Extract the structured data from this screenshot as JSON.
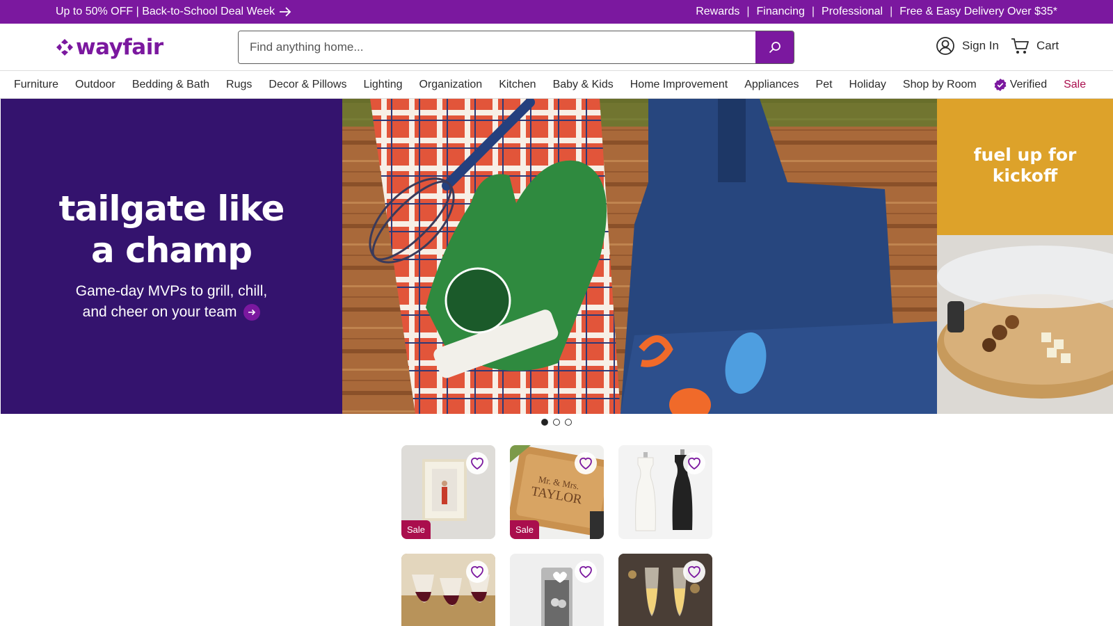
{
  "promo": {
    "left_text": "Up to 50% OFF | Back-to-School Deal Week",
    "links": [
      "Rewards",
      "Financing",
      "Professional",
      "Free & Easy Delivery Over $35*"
    ]
  },
  "header": {
    "logo": "wayfair",
    "search_placeholder": "Find anything home...",
    "sign_in": "Sign In",
    "cart": "Cart"
  },
  "nav": {
    "items": [
      "Furniture",
      "Outdoor",
      "Bedding & Bath",
      "Rugs",
      "Decor & Pillows",
      "Lighting",
      "Organization",
      "Kitchen",
      "Baby & Kids",
      "Home Improvement",
      "Appliances",
      "Pet",
      "Holiday",
      "Shop by Room"
    ],
    "verified": "Verified",
    "sale": "Sale"
  },
  "hero": {
    "title_line1": "tailgate like",
    "title_line2": "a champ",
    "sub_line1": "Game-day MVPs to grill, chill,",
    "sub_line2": "and cheer on your team",
    "side_title_line1": "fuel up for",
    "side_title_line2": "kickoff",
    "slides_total": 3,
    "slide_active": 1
  },
  "products": {
    "sale_label": "Sale",
    "items": [
      {
        "type": "picture frame",
        "sale": true
      },
      {
        "type": "cutting board",
        "sale": true
      },
      {
        "type": "salt and pepper mills",
        "sale": false
      },
      {
        "type": "wine glasses",
        "sale": false
      },
      {
        "type": "photo ornament",
        "sale": false
      },
      {
        "type": "champagne flutes",
        "sale": false
      }
    ],
    "board_engraving_line1": "Mr. & Mrs.",
    "board_engraving_line2": "TAYLOR"
  },
  "colors": {
    "brand_purple": "#7b189f",
    "hero_purple": "#34136e",
    "hero_gold": "#dda22a",
    "sale_red": "#aa0e4d"
  }
}
